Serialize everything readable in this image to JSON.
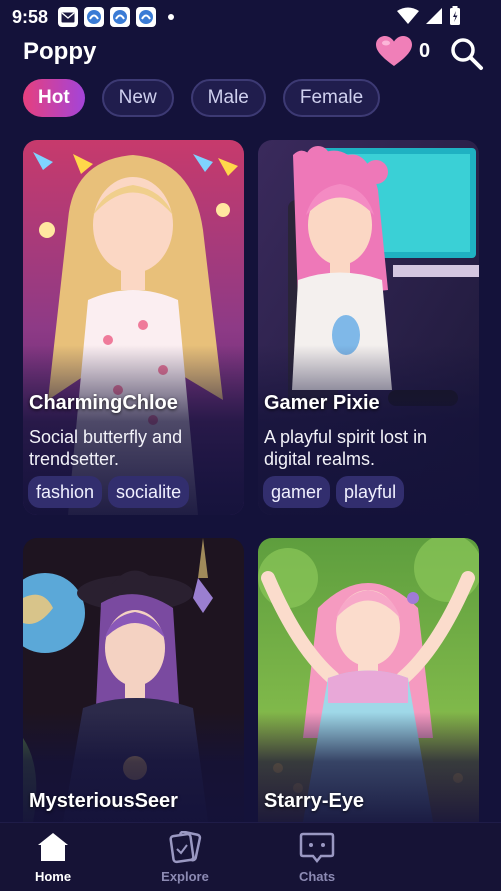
{
  "status_bar": {
    "time": "9:58"
  },
  "header": {
    "title": "Poppy",
    "heart_count": "0"
  },
  "filters": [
    "Hot",
    "New",
    "Male",
    "Female"
  ],
  "cards": [
    {
      "name": "CharmingChloe",
      "description": "Social butterfly and trendsetter.",
      "tags": [
        "fashion",
        "socialite"
      ]
    },
    {
      "name": "Gamer Pixie",
      "description": "A playful spirit lost in digital realms.",
      "tags": [
        "gamer",
        "playful"
      ]
    },
    {
      "name": "MysteriousSeer"
    },
    {
      "name": "Starry-Eye"
    }
  ],
  "nav": {
    "home": "Home",
    "explore": "Explore",
    "chats": "Chats"
  },
  "colors": {
    "background": "#14123a",
    "accent_gradient_start": "#e6407e",
    "accent_gradient_end": "#a344d9",
    "heart": "#f07fb8",
    "tag_bg": "#322e6e"
  },
  "icons": {
    "heart": "heart-icon",
    "search": "search-icon",
    "home": "home-icon",
    "explore": "cards-icon",
    "chats": "chat-bubble-icon"
  }
}
